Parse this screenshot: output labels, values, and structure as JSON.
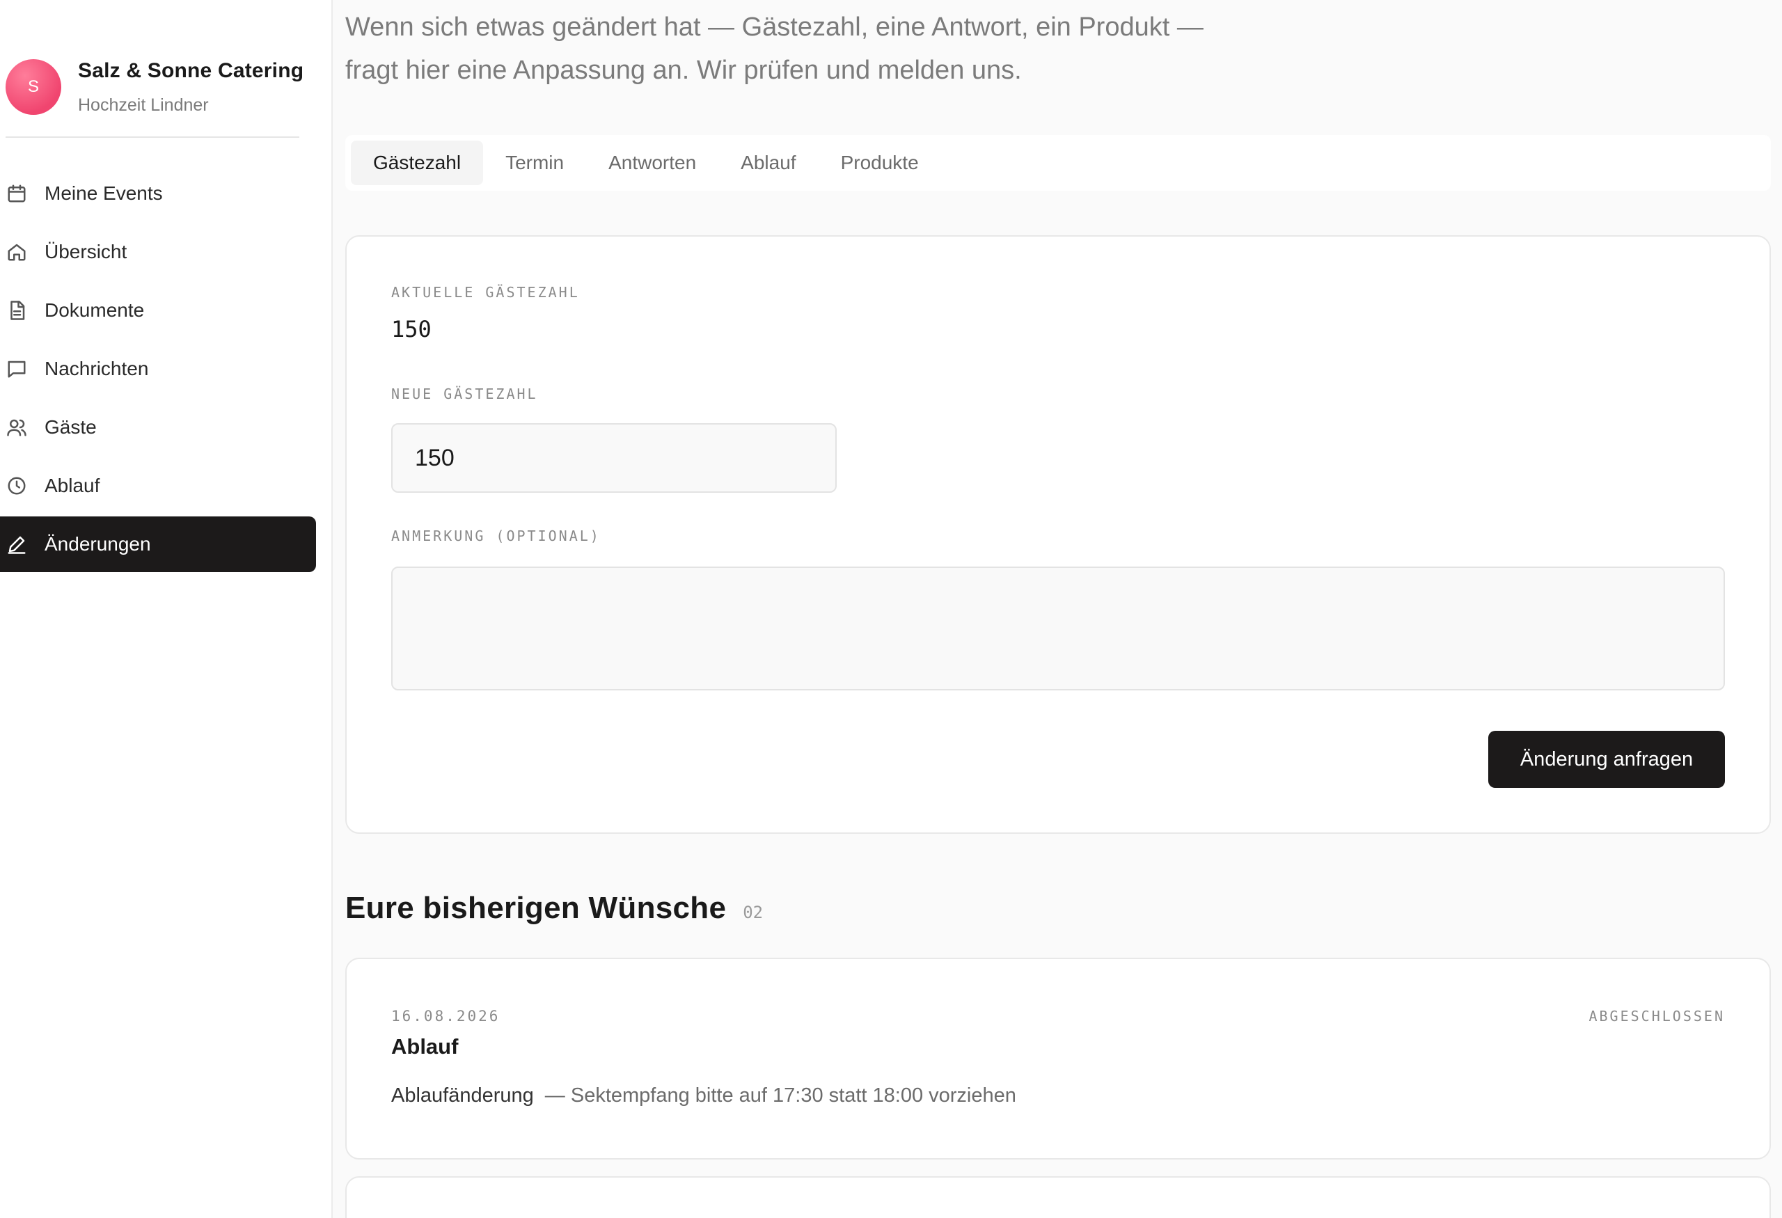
{
  "brand": {
    "avatar_letter": "S",
    "name": "Salz & Sonne Catering",
    "subtitle": "Hochzeit Lindner",
    "avatar_color": "#f0456f"
  },
  "nav": {
    "items": [
      {
        "label": "Meine Events",
        "icon": "calendar-icon"
      },
      {
        "label": "Übersicht",
        "icon": "home-icon"
      },
      {
        "label": "Dokumente",
        "icon": "document-icon"
      },
      {
        "label": "Nachrichten",
        "icon": "message-icon"
      },
      {
        "label": "Gäste",
        "icon": "users-icon"
      },
      {
        "label": "Ablauf",
        "icon": "clock-icon"
      },
      {
        "label": "Änderungen",
        "icon": "pencil-icon",
        "active": true
      }
    ]
  },
  "intro": {
    "line1": "Wenn sich etwas geändert hat — Gästezahl, eine Antwort, ein Produkt —",
    "line2": "fragt hier eine Anpassung an. Wir prüfen und melden uns."
  },
  "tabs": [
    {
      "label": "Gästezahl",
      "active": true
    },
    {
      "label": "Termin"
    },
    {
      "label": "Antworten"
    },
    {
      "label": "Ablauf"
    },
    {
      "label": "Produkte"
    }
  ],
  "form": {
    "current_label": "AKTUELLE GÄSTEZAHL",
    "current_value": "150",
    "new_label": "NEUE GÄSTEZAHL",
    "new_value": "150",
    "note_label": "ANMERKUNG (OPTIONAL)",
    "note_value": "",
    "submit_label": "Änderung anfragen"
  },
  "requests": {
    "title": "Eure bisherigen Wünsche",
    "count": "02",
    "items": [
      {
        "date": "16.08.2026",
        "status": "ABGESCHLOSSEN",
        "title": "Ablauf",
        "type": "Ablaufänderung",
        "detail": "— Sektempfang bitte auf 17:30 statt 18:00 vorziehen"
      }
    ]
  },
  "colors": {
    "accent_dark": "#1c1a1a",
    "background": "#fafafa"
  }
}
